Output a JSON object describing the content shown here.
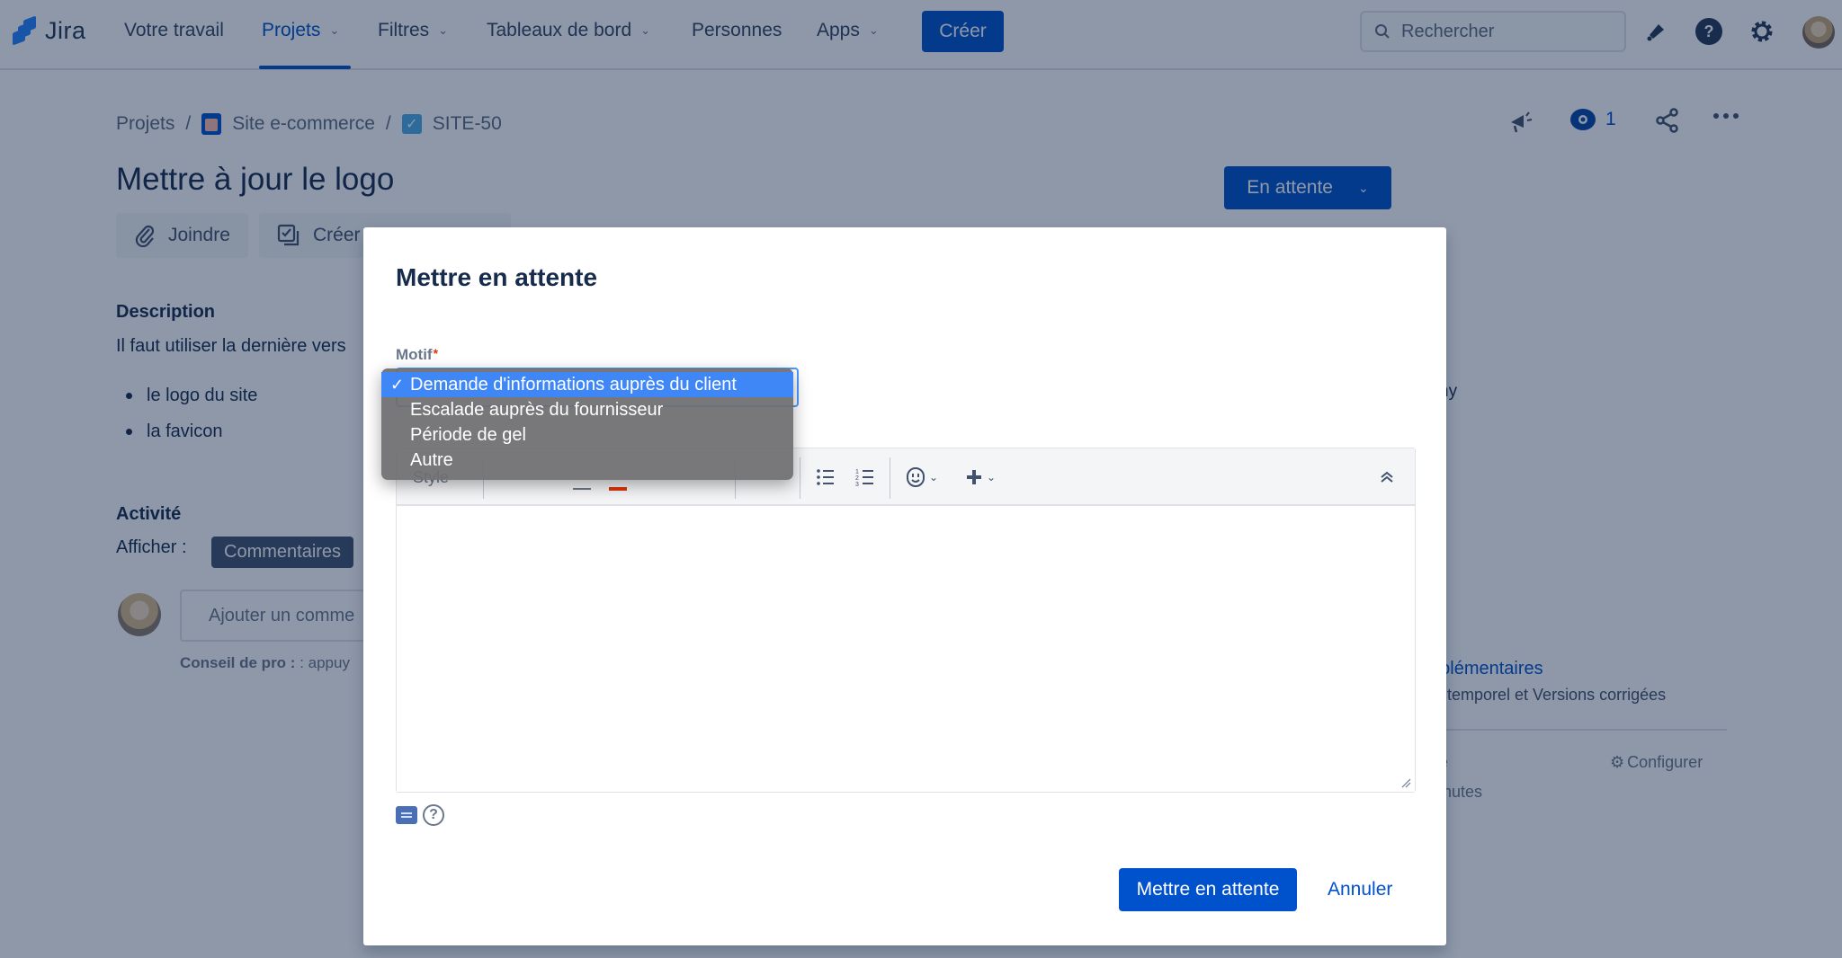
{
  "topnav": {
    "logo_text": "Jira",
    "items": [
      {
        "label": "Votre travail",
        "has_chevron": false
      },
      {
        "label": "Projets",
        "has_chevron": true,
        "active": true
      },
      {
        "label": "Filtres",
        "has_chevron": true
      },
      {
        "label": "Tableaux de bord",
        "has_chevron": true
      },
      {
        "label": "Personnes",
        "has_chevron": false
      },
      {
        "label": "Apps",
        "has_chevron": true
      }
    ],
    "create_label": "Créer",
    "search_placeholder": "Rechercher",
    "icons": [
      "notifications-icon",
      "help-icon",
      "settings-icon",
      "user-avatar"
    ]
  },
  "breadcrumb": {
    "items": [
      "Projets",
      "Site e-commerce",
      "SITE-50"
    ],
    "separator": "/"
  },
  "issue": {
    "title": "Mettre à jour le logo",
    "actions": [
      "Joindre",
      "Créer"
    ],
    "status": "En attente",
    "watchers_count": "1",
    "description_heading": "Description",
    "description_text": "Il faut utiliser la dernière vers",
    "description_items": [
      "le logo du site",
      "la favicon"
    ],
    "activity_heading": "Activité",
    "show_label": "Afficher :",
    "show_filter": "Commentaires",
    "comment_placeholder": "Ajouter un comme",
    "tip_bold": "Conseil de pro :",
    "tip_text": " : appuy"
  },
  "right_panel_fragments": {
    "fragment_1": "ny",
    "more_fields_link": "pplémentaires",
    "more_fields_desc": "i temporel et Versions corrigées",
    "fragment_2": "e",
    "configure_label": "Configurer",
    "fragment_3": "inutes"
  },
  "modal": {
    "title": "Mettre en attente",
    "field_label": "Motif",
    "required_marker": "*",
    "select_options": [
      "Demande d'informations auprès du client",
      "Escalade auprès du fournisseur",
      "Période de gel",
      "Autre"
    ],
    "selected_index": 0,
    "check_mark": "✓",
    "toolbar": {
      "style_label": "Style",
      "items": [
        "bullet-list-icon",
        "numbered-list-icon",
        "emoji-icon",
        "insert-plus-icon",
        "collapse-toolbar-icon"
      ]
    },
    "submit_label": "Mettre en attente",
    "cancel_label": "Annuler"
  },
  "colors": {
    "brand_blue": "#0052cc",
    "selected_option": "#3f86f7",
    "overlay": "rgba(9,30,66,0.46)"
  }
}
